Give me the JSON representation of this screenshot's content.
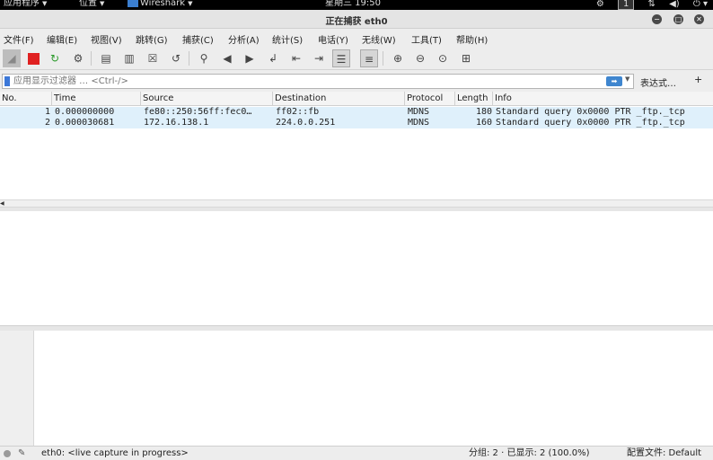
{
  "topbar": {
    "apps": "应用程序",
    "places": "位置",
    "app_name": "Wireshark",
    "clock": "星期三 19:50",
    "workspace": "1",
    "icons": [
      "network-icon",
      "volume-icon",
      "power-icon"
    ]
  },
  "window": {
    "title": "正在捕获 eth0"
  },
  "menu": [
    "文件(F)",
    "编辑(E)",
    "视图(V)",
    "跳转(G)",
    "捕获(C)",
    "分析(A)",
    "统计(S)",
    "电话(Y)",
    "无线(W)",
    "工具(T)",
    "帮助(H)"
  ],
  "filter": {
    "placeholder": "应用显示过滤器 … <Ctrl-/>",
    "expression_label": "表达式…",
    "add_label": "+"
  },
  "packet_list": {
    "columns": [
      "No.",
      "Time",
      "Source",
      "Destination",
      "Protocol",
      "Length",
      "Info"
    ],
    "rows": [
      {
        "no": "1",
        "time": "0.000000000",
        "source": "fe80::250:56ff:fec0…",
        "destination": "ff02::fb",
        "protocol": "MDNS",
        "length": "180",
        "info": "Standard query 0x0000 PTR _ftp._tcp"
      },
      {
        "no": "2",
        "time": "0.000030681",
        "source": "172.16.138.1",
        "destination": "224.0.0.251",
        "protocol": "MDNS",
        "length": "160",
        "info": "Standard query 0x0000 PTR _ftp._tcp"
      }
    ]
  },
  "status": {
    "capture": "eth0: <live capture in progress>",
    "packets": "分组: 2 · 已显示: 2 (100.0%)",
    "profile": "配置文件: Default"
  },
  "colors": {
    "row_bg": "#dff0fb",
    "stop_red": "#e02020",
    "accent_blue": "#3f86cf"
  }
}
